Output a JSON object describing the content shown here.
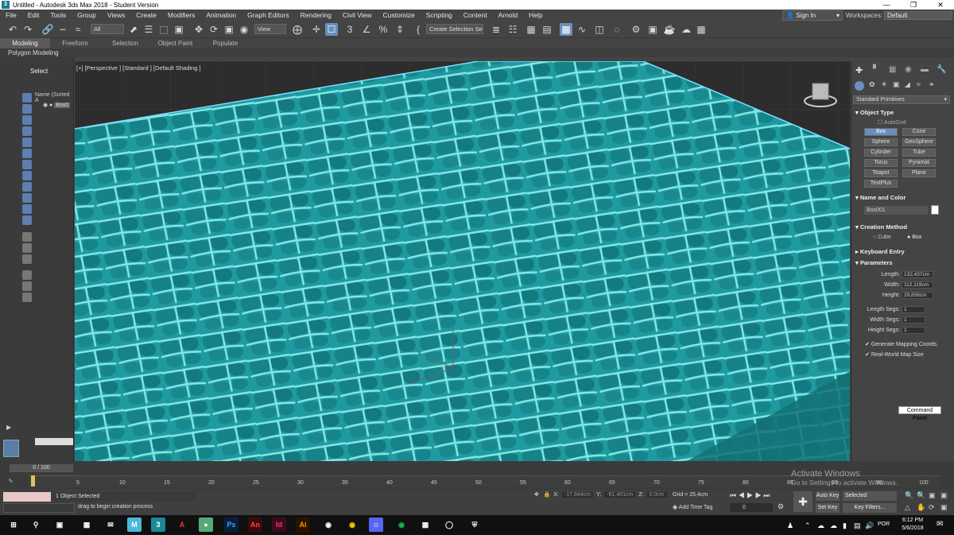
{
  "window": {
    "title": "Untitled - Autodesk 3ds Max 2018 - Student Version",
    "app_icon": "3"
  },
  "menu": [
    "File",
    "Edit",
    "Tools",
    "Group",
    "Views",
    "Create",
    "Modifiers",
    "Animation",
    "Graph Editors",
    "Rendering",
    "Civil View",
    "Customize",
    "Scripting",
    "Content",
    "Arnold",
    "Help"
  ],
  "account": {
    "sign_in": "Sign In",
    "workspaces_label": "Workspaces:",
    "workspace": "Default"
  },
  "toolbar": {
    "filter": "All",
    "refcoord": "View",
    "selection_set": "Create Selection Se"
  },
  "ribbon": {
    "tabs": [
      "Modeling",
      "Freeform",
      "Selection",
      "Object Paint",
      "Populate"
    ],
    "active": "Modeling",
    "panel": "Polygon Modeling"
  },
  "scene_explorer": {
    "title": "Select",
    "column": "Name (Sorted A",
    "item": "Box0"
  },
  "viewport": {
    "label": "[+] [Perspective ] [Standard ] [Default Shading ]"
  },
  "command_panel": {
    "category": "Standard Primitives",
    "object_type": {
      "title": "Object Type",
      "autogrid": "AutoGrid",
      "buttons": [
        "Box",
        "Cone",
        "Sphere",
        "GeoSphere",
        "Cylinder",
        "Tube",
        "Torus",
        "Pyramid",
        "Teapot",
        "Plane",
        "TextPlus"
      ],
      "active": "Box"
    },
    "name_color": {
      "title": "Name and Color",
      "name": "Box001",
      "color": "#ffffff"
    },
    "creation_method": {
      "title": "Creation Method",
      "options": [
        "Cube",
        "Box"
      ],
      "selected": "Box"
    },
    "keyboard_entry": {
      "title": "Keyboard Entry"
    },
    "parameters": {
      "title": "Parameters",
      "fields": [
        {
          "label": "Length:",
          "value": "132,437cm"
        },
        {
          "label": "Width:",
          "value": "112,119cm"
        },
        {
          "label": "Height:",
          "value": "29,856cm"
        },
        {
          "label": "Length Segs:",
          "value": "1"
        },
        {
          "label": "Width Segs:",
          "value": "1"
        },
        {
          "label": "Height Segs:",
          "value": "1"
        }
      ],
      "checkboxes": [
        "Generate Mapping Coords.",
        "Real-World Map Size"
      ]
    },
    "tooltip": "Command Panel"
  },
  "timeline": {
    "frame": "0 / 100",
    "ticks": [
      "0",
      "5",
      "10",
      "15",
      "20",
      "25",
      "30",
      "35",
      "40",
      "45",
      "50",
      "55",
      "60",
      "65",
      "70",
      "75",
      "80",
      "85",
      "90",
      "95",
      "100"
    ]
  },
  "status": {
    "selection": "1 Object Selected",
    "prompt": "drag to begin creation process",
    "x": "-17,844cm",
    "y": "-61,401cm",
    "z": "0,0cm",
    "grid": "Grid = 25,4cm",
    "add_time_tag": "Add Time Tag",
    "frame_field": "0",
    "auto_key": "Auto Key",
    "set_key": "Set Key",
    "selected": "Selected",
    "key_filters": "Key Filters..."
  },
  "watermark": {
    "line1": "Activate Windows",
    "line2": "Go to Settings to activate Windows."
  },
  "taskbar": {
    "lang": "POR",
    "time": "6:12 PM",
    "date": "5/6/2018"
  },
  "colors": {
    "water": "#1f8f96",
    "water_light": "#6fe0e0",
    "accent": "#6a8fbf"
  }
}
